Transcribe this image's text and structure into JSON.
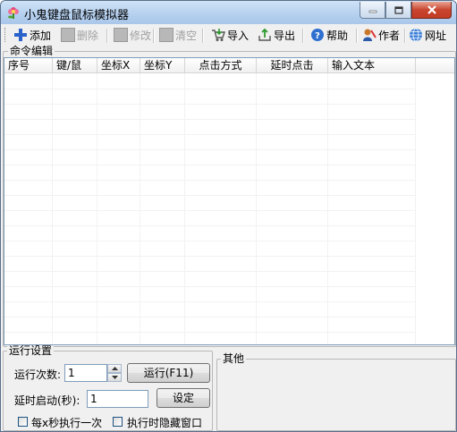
{
  "window": {
    "title": "小鬼键盘鼠标模拟器",
    "buttons": [
      "minimize",
      "maximize",
      "close"
    ]
  },
  "toolbar": {
    "items": [
      {
        "label": "添加",
        "icon": "plus-icon",
        "enabled": true
      },
      {
        "label": "删除",
        "icon": "gray-square-icon",
        "enabled": false
      },
      {
        "label": "修改",
        "icon": "gray-square-icon",
        "enabled": false
      },
      {
        "label": "清空",
        "icon": "gray-square-icon",
        "enabled": false
      },
      {
        "label": "导入",
        "icon": "import-cart-icon",
        "enabled": true
      },
      {
        "label": "导出",
        "icon": "export-icon",
        "enabled": true
      },
      {
        "label": "帮助",
        "icon": "help-icon",
        "enabled": true
      },
      {
        "label": "作者",
        "icon": "author-icon",
        "enabled": true
      },
      {
        "label": "网址",
        "icon": "globe-icon",
        "enabled": true
      }
    ]
  },
  "command_group": {
    "title": "命令编辑",
    "columns": [
      "序号",
      "键/鼠",
      "坐标X",
      "坐标Y",
      "点击方式",
      "延时点击",
      "输入文本"
    ],
    "rows": []
  },
  "run_group": {
    "title": "运行设置",
    "run_count_label": "运行次数:",
    "run_count_value": "1",
    "run_button": "运行(F11)",
    "delay_label": "延时启动(秒):",
    "delay_value": "1",
    "set_button": "设定",
    "every_x_label": "每x秒执行一次",
    "every_x_checked": false,
    "hide_window_label": "执行时隐藏窗口",
    "hide_window_checked": false
  },
  "other_group": {
    "title": "其他"
  }
}
